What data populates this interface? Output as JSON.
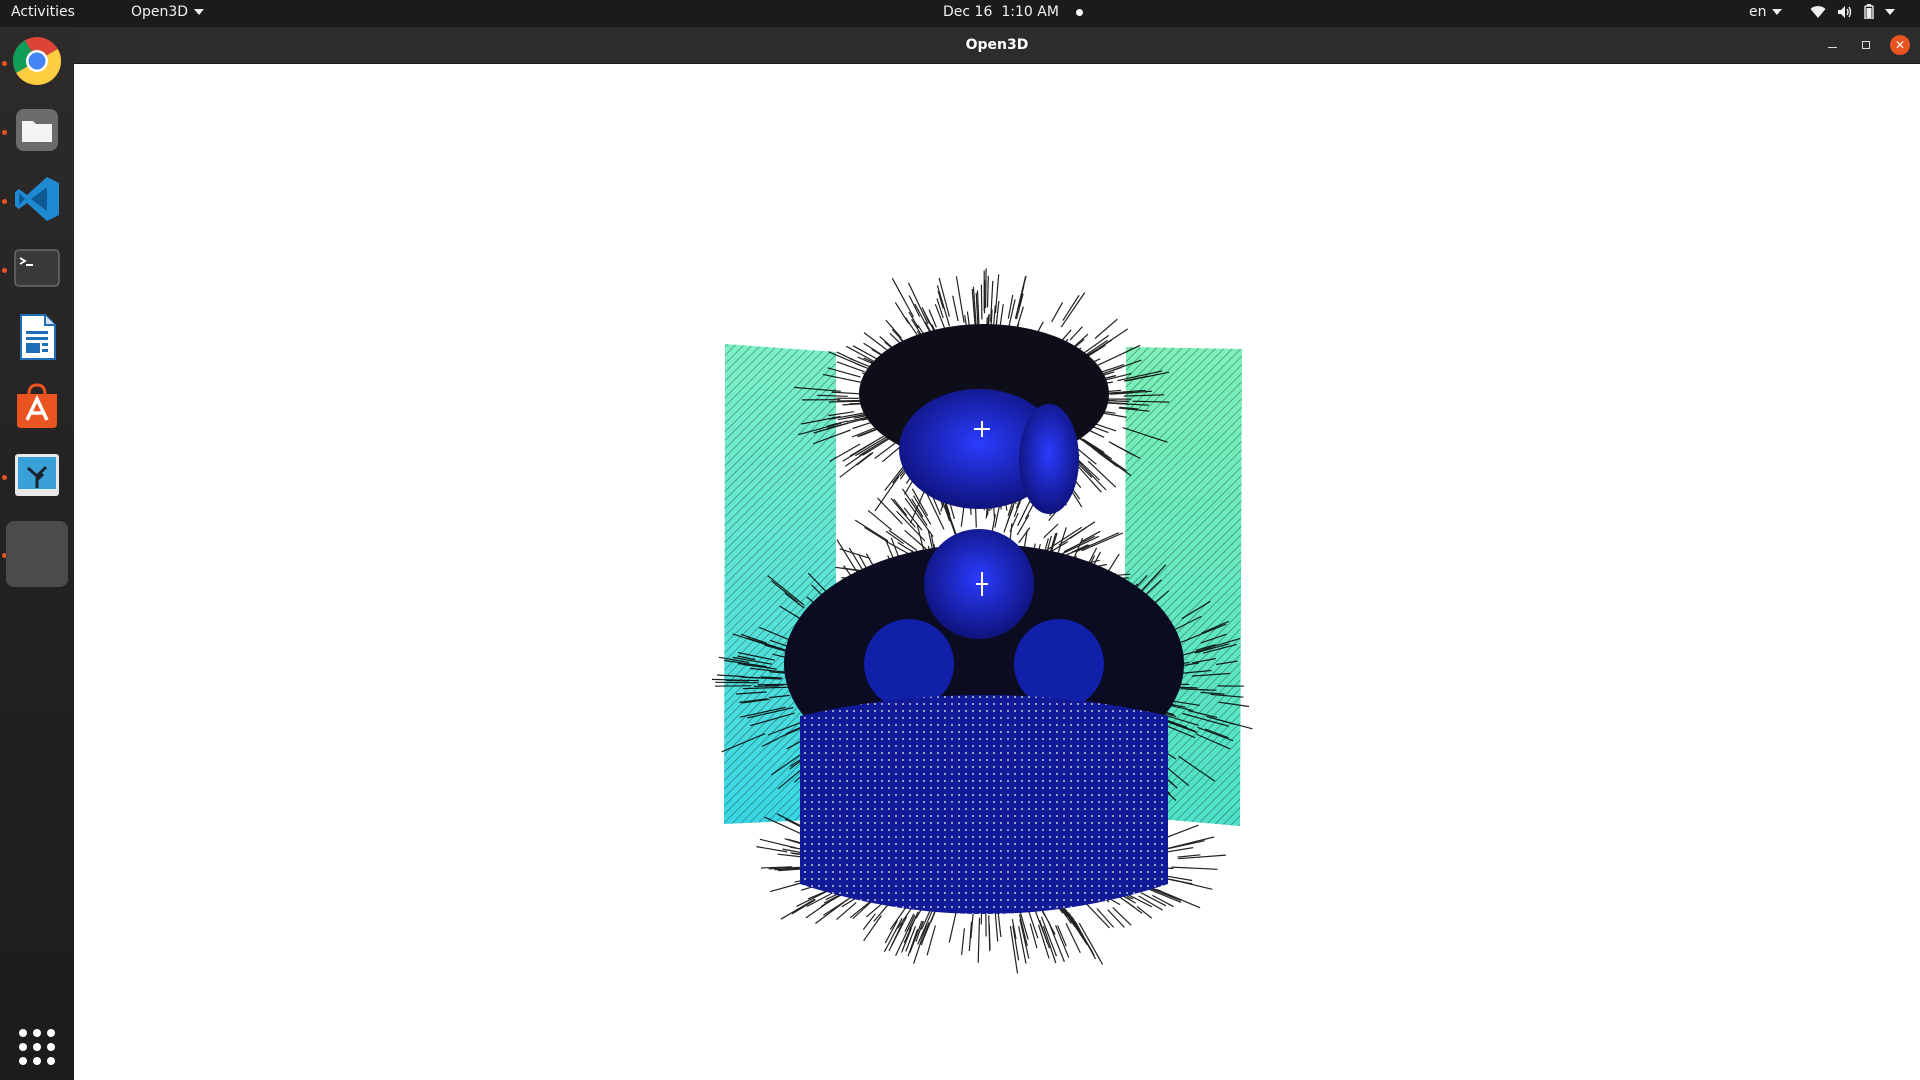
{
  "topbar": {
    "activities": "Activities",
    "app_menu": "Open3D",
    "date": "Dec 16",
    "time": "1:10 AM",
    "language": "en"
  },
  "dock": {
    "items": [
      {
        "name": "chrome",
        "running": true
      },
      {
        "name": "files",
        "running": true
      },
      {
        "name": "vscode",
        "running": true
      },
      {
        "name": "terminal",
        "running": true
      },
      {
        "name": "libreoffice-writer",
        "running": false
      },
      {
        "name": "ubuntu-software",
        "running": false
      },
      {
        "name": "image-viewer",
        "running": true
      },
      {
        "name": "open3d",
        "running": true
      }
    ]
  },
  "window": {
    "title": "Open3D"
  },
  "colors": {
    "accent": "#e95420",
    "panel": "#1b1b1b",
    "titlebar": "#2c2c2c",
    "cloud_blue": "#1a2ad6",
    "cloud_cyan": "#4fe8c8",
    "normals": "#111111"
  }
}
